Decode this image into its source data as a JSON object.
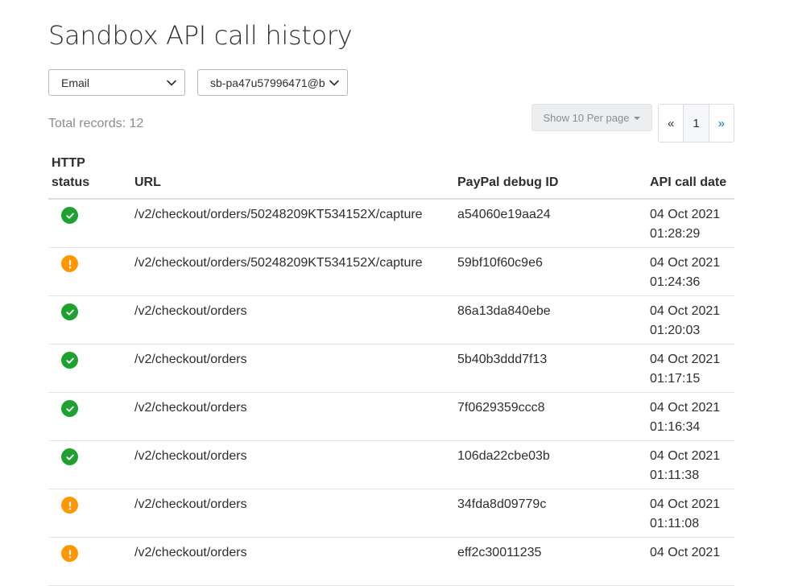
{
  "page": {
    "title": "Sandbox API call history"
  },
  "filters": {
    "type_select": {
      "value": "Email"
    },
    "email_select": {
      "value": "sb-pa47u57996471@b"
    }
  },
  "summary": {
    "total_records": "Total records: 12"
  },
  "pagination": {
    "per_page_label": "Show 10 Per page",
    "prev_label": "«",
    "current_page": "1",
    "next_label": "»"
  },
  "colors": {
    "success": "#1fa12f",
    "warning": "#ff9600",
    "link": "#0070ba"
  },
  "table": {
    "headers": {
      "status_line1": "HTTP",
      "status_line2": "status",
      "url": "URL",
      "debug_id": "PayPal debug ID",
      "date": "API call date"
    },
    "rows": [
      {
        "status": "success",
        "status_icon": "check-icon",
        "url": "/v2/checkout/orders/50248209KT534152X/capture",
        "debug_id": "a54060e19aa24",
        "date": "04 Oct 2021",
        "time": "01:28:29"
      },
      {
        "status": "warning",
        "status_icon": "exclamation-icon",
        "url": "/v2/checkout/orders/50248209KT534152X/capture",
        "debug_id": "59bf10f60c9e6",
        "date": "04 Oct 2021",
        "time": "01:24:36"
      },
      {
        "status": "success",
        "status_icon": "check-icon",
        "url": "/v2/checkout/orders",
        "debug_id": "86a13da840ebe",
        "date": "04 Oct 2021",
        "time": "01:20:03"
      },
      {
        "status": "success",
        "status_icon": "check-icon",
        "url": "/v2/checkout/orders",
        "debug_id": "5b40b3ddd7f13",
        "date": "04 Oct 2021",
        "time": "01:17:15"
      },
      {
        "status": "success",
        "status_icon": "check-icon",
        "url": "/v2/checkout/orders",
        "debug_id": "7f0629359ccc8",
        "date": "04 Oct 2021",
        "time": "01:16:34"
      },
      {
        "status": "success",
        "status_icon": "check-icon",
        "url": "/v2/checkout/orders",
        "debug_id": "106da22cbe03b",
        "date": "04 Oct 2021",
        "time": "01:11:38"
      },
      {
        "status": "warning",
        "status_icon": "exclamation-icon",
        "url": "/v2/checkout/orders",
        "debug_id": "34fda8d09779c",
        "date": "04 Oct 2021",
        "time": "01:11:08"
      },
      {
        "status": "warning",
        "status_icon": "exclamation-icon",
        "url": "/v2/checkout/orders",
        "debug_id": "eff2c30011235",
        "date": "04 Oct 2021",
        "time": ""
      }
    ]
  }
}
